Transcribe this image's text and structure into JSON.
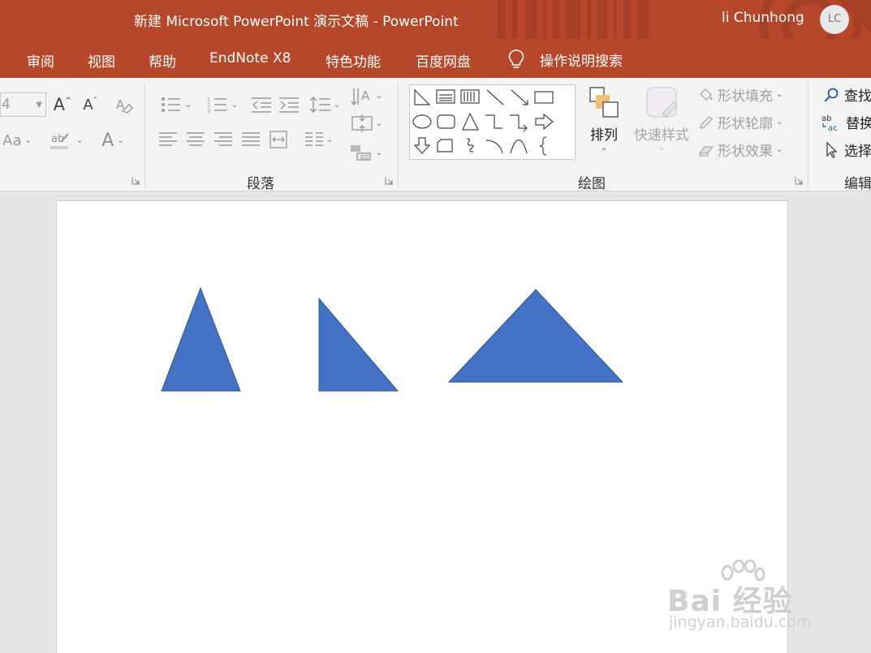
{
  "window": {
    "title": "新建 Microsoft PowerPoint 演示文稿  -  PowerPoint",
    "user_name": "li Chunhong",
    "user_initials": "LC"
  },
  "tabs": [
    "审阅",
    "视图",
    "帮助",
    "EndNote X8",
    "特色功能",
    "百度网盘"
  ],
  "tell_me": "操作说明搜索",
  "ribbon": {
    "font": {
      "size_value": "4",
      "grow_glyph": "A",
      "shrink_glyph": "A",
      "case_glyph": "Aa",
      "color_glyph": "A"
    },
    "paragraph": {
      "label": "段落"
    },
    "drawing": {
      "label": "绘图",
      "arrange_label": "排列",
      "quick_styles_label": "快速样式",
      "shape_fill": "形状填充",
      "shape_outline": "形状轮廓",
      "shape_effects": "形状效果"
    },
    "editing": {
      "label": "编辑",
      "find": "查找",
      "replace": "替换",
      "select": "选择"
    }
  },
  "slide": {
    "shape_color": "#4472c4",
    "shape_outline_color": "#2f5597",
    "shapes": [
      "isosceles-triangle",
      "right-triangle",
      "isosceles-triangle"
    ]
  },
  "watermark": {
    "text": "Bai 经验",
    "url": "jingyan.baidu.com"
  },
  "colors": {
    "accent": "#b7472a",
    "ribbon_bg": "#f3f3f3",
    "workspace_bg": "#e6e6e6"
  }
}
